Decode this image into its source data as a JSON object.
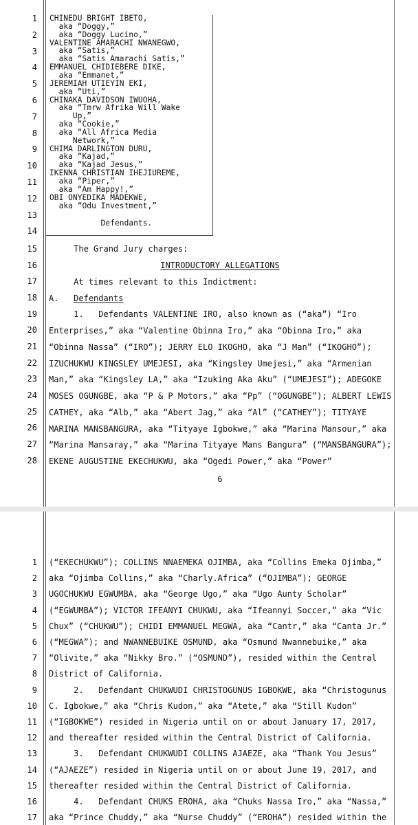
{
  "document": {
    "page1": {
      "caption_lines": [
        "CHINEDU BRIGHT IBETO,",
        "  aka “Doggy,”",
        "  aka “Doggy Lucino,”",
        "VALENTINE AMARACHI NWANEGWO,",
        "  aka “Satis,”",
        "  aka “Satis Amarachi Satis,”",
        "EMMANUEL CHIDIEBERE DIKE,",
        "  aka “Emmanet,”",
        "JEREMIAH UTIEYIN EKI,",
        "  aka “Uti,”",
        "CHINAKA DAVIDSON IWUOHA,",
        "  aka “Tmrw Afrika Will Wake",
        "     Up,”",
        "  aka “Cookie,”",
        "  aka “All Africa Media",
        "     Network,”",
        "CHIMA DARLINGTON DURU,",
        "  aka “Kajad,”",
        "  aka “Kajad Jesus,”",
        "IKENNA CHRISTIAN IHEJIUREME,",
        "  aka “Piper,”",
        "  aka “Am Happy!,”",
        "OBI ONYEDIKA MADEKWE,",
        "  aka “Odu Investment,”",
        "",
        "           Defendants."
      ],
      "line_numbers": [
        "1",
        "2",
        "3",
        "4",
        "5",
        "6",
        "7",
        "8",
        "9",
        "10",
        "11",
        "12",
        "13",
        "14",
        "15",
        "16",
        "17",
        "18",
        "19",
        "20",
        "21",
        "22",
        "23",
        "24",
        "25",
        "26",
        "27",
        "28"
      ],
      "body": {
        "l15": "     The Grand Jury charges:",
        "l16_heading": "INTRODUCTORY ALLEGATIONS",
        "l17": "     At times relevant to this Indictment:",
        "l18_marker": "A.",
        "l18_heading": "Defendants",
        "l19": "     1.   Defendants VALENTINE IRO, also known as (“aka”) “Iro",
        "l20": "Enterprises,” aka “Valentine Obinna Iro,” aka “Obinna Iro,” aka",
        "l21": "“Obinna Nassa” (“IRO”); JERRY ELO IKOGHO, aka “J Man” (“IKOGHO”);",
        "l22": "IZUCHUKWU KINGSLEY UMEJESI, aka “Kingsley Umejesi,” aka “Armenian",
        "l23": "Man,” aka “Kingsley LA,” aka “Izuking Aka Aku” (“UMEJESI”); ADEGOKE",
        "l24": "MOSES OGUNGBE, aka “P & P Motors,” aka “Pp” (“OGUNGBE”); ALBERT LEWIS",
        "l25": "CATHEY, aka “Alb,” aka “Abert Jag,” aka “Al” (“CATHEY”); TITYAYE",
        "l26": "MARINA MANSBANGURA, aka “Tityaye Igbokwe,” aka “Marina Mansour,” aka",
        "l27": "“Marina Mansaray,” aka “Marina Tityaye Mans Bangura” (“MANSBANGURA”);",
        "l28": "EKENE AUGUSTINE EKECHUKWU, aka “Ogedi Power,” aka “Power”"
      },
      "page_number": "6"
    },
    "page2": {
      "line_numbers": [
        "1",
        "2",
        "3",
        "4",
        "5",
        "6",
        "7",
        "8",
        "9",
        "10",
        "11",
        "12",
        "13",
        "14",
        "15",
        "16",
        "17"
      ],
      "lines": [
        "(“EKECHUKWU”); COLLINS NNAEMEKA OJIMBA, aka “Collins Emeka Ojimba,”",
        "aka “Ojimba Collins,” aka “Charly.Africa” (“OJIMBA”); GEORGE",
        "UGOCHUKWU EGWUMBA, aka “George Ugo,” aka “Ugo Aunty Scholar”",
        "(“EGWUMBA”); VICTOR IFEANYI CHUKWU, aka “Ifeannyi Soccer,” aka “Vic",
        "Chux” (“CHUKWU”); CHIDI EMMANUEL MEGWA, aka “Cantr,” aka “Canta Jr.”",
        "(“MEGWA”); and NWANNEBUIKE OSMUND, aka “Osmund Nwannebuike,” aka",
        "“Olivite,” aka “Nikky Bro.” (“OSMUND”), resided within the Central",
        "District of California.",
        "     2.   Defendant CHUKWUDI CHRISTOGUNUS IGBOKWE, aka “Christogunus",
        "C. Igbokwe,” aka “Chris Kudon,” aka “Atete,” aka “Still Kudon”",
        "(“IGBOKWE”) resided in Nigeria until on or about January 17, 2017,",
        "and thereafter resided within the Central District of California.",
        "     3.   Defendant CHUKWUDI COLLINS AJAEZE, aka “Thank You Jesus”",
        "(“AJAEZE”) resided in Nigeria until on or about June 19, 2017, and",
        "thereafter resided within the Central District of California.",
        "     4.   Defendant CHUKS EROHA, aka “Chuks Nassa Iro,” aka “Nassa,”",
        "aka “Prince Chuddy,” aka “Nurse Chuddy” (“EROHA”) resided within the"
      ]
    }
  }
}
